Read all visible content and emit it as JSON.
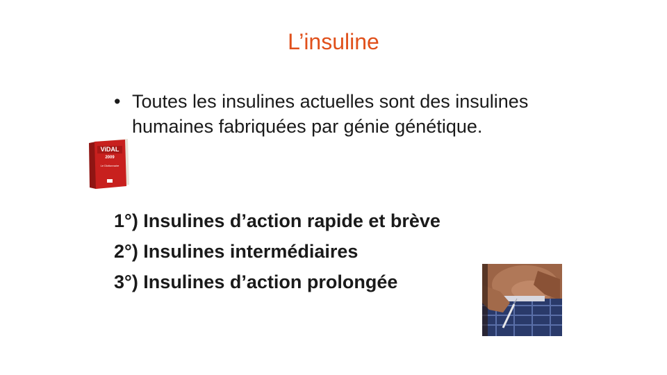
{
  "title": "L’insuline",
  "bullet": {
    "symbol": "•",
    "text": "Toutes les insulines actuelles sont des insulines humaines fabriquées par génie génétique."
  },
  "list": [
    "1°) Insulines d’action rapide et brève",
    "2°) Insulines intermédiaires",
    "3°) Insulines d’action prolongée"
  ],
  "book": {
    "logo_text": "ViDAL",
    "year": "2009",
    "subtitle": "Le Dictionnaire"
  },
  "colors": {
    "title": "#e0501b",
    "text": "#1a1a1a",
    "book_red": "#c8201e"
  }
}
